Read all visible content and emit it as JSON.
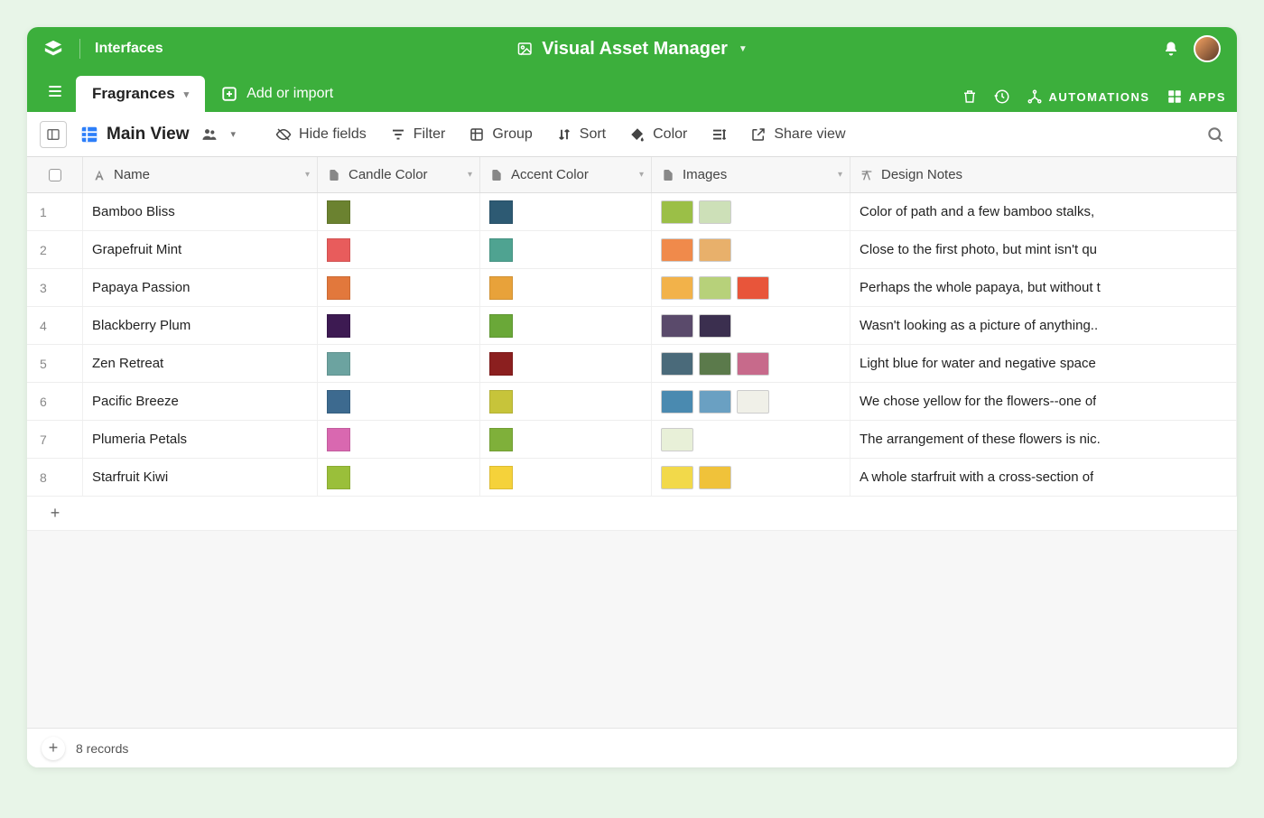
{
  "header": {
    "interfaces_label": "Interfaces",
    "app_title": "Visual Asset Manager"
  },
  "tabs": {
    "active_tab": "Fragrances",
    "add_import": "Add or import",
    "automations": "AUTOMATIONS",
    "apps": "APPS"
  },
  "viewbar": {
    "view_name": "Main View",
    "hide_fields": "Hide fields",
    "filter": "Filter",
    "group": "Group",
    "sort": "Sort",
    "color": "Color",
    "share_view": "Share view"
  },
  "columns": {
    "name": "Name",
    "candle_color": "Candle Color",
    "accent_color": "Accent Color",
    "images": "Images",
    "design_notes": "Design Notes"
  },
  "rows": [
    {
      "num": "1",
      "name": "Bamboo Bliss",
      "candle": "#6b8230",
      "accent": "#2d5a73",
      "images": [
        "#9bbf47",
        "#cde0b8"
      ],
      "notes": "Color of path and a few bamboo stalks,"
    },
    {
      "num": "2",
      "name": "Grapefruit Mint",
      "candle": "#e85c5c",
      "accent": "#4fa391",
      "images": [
        "#f08a4b",
        "#e8b06b"
      ],
      "notes": "Close to the first photo, but mint isn't qu"
    },
    {
      "num": "3",
      "name": "Papaya Passion",
      "candle": "#e2783c",
      "accent": "#e8a23a",
      "images": [
        "#f2b24a",
        "#b7d17a",
        "#e8553a"
      ],
      "notes": "Perhaps the whole papaya, but without t"
    },
    {
      "num": "4",
      "name": "Blackberry Plum",
      "candle": "#3d1a52",
      "accent": "#6aa838",
      "images": [
        "#5a4a6b",
        "#3b2f4f"
      ],
      "notes": "Wasn't looking as a picture of anything.."
    },
    {
      "num": "5",
      "name": "Zen Retreat",
      "candle": "#6ca3a0",
      "accent": "#8b1f1f",
      "images": [
        "#4a6a7a",
        "#5b7a4b",
        "#c76a8b"
      ],
      "notes": "Light blue for water and negative space"
    },
    {
      "num": "6",
      "name": "Pacific Breeze",
      "candle": "#3d6a8f",
      "accent": "#c7c43a",
      "images": [
        "#4a8ab0",
        "#6aa0c2",
        "#f0f0e8"
      ],
      "notes": "We chose yellow for the flowers--one of"
    },
    {
      "num": "7",
      "name": "Plumeria Petals",
      "candle": "#d968b0",
      "accent": "#7fb03a",
      "images": [
        "#e8f0d8"
      ],
      "notes": "The arrangement of these flowers is nic."
    },
    {
      "num": "8",
      "name": "Starfruit Kiwi",
      "candle": "#9abf3a",
      "accent": "#f5d23a",
      "images": [
        "#f2d94a",
        "#f0c23a"
      ],
      "notes": "A whole starfruit with a cross-section of"
    }
  ],
  "footer": {
    "record_count": "8 records"
  }
}
